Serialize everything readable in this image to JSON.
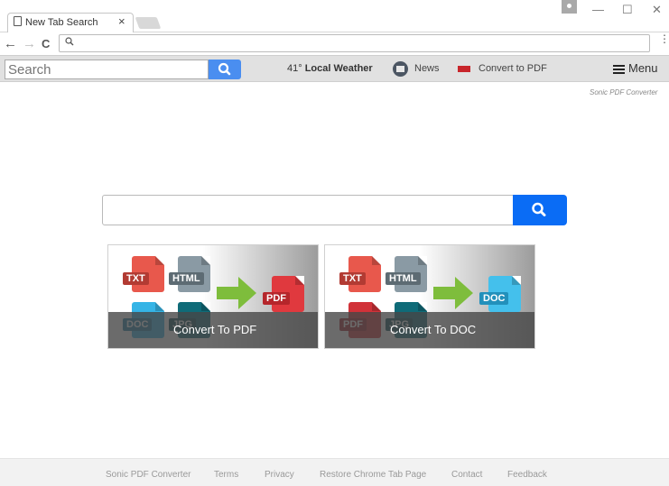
{
  "browser": {
    "tab_title": "New Tab Search",
    "tab_close": "×",
    "window_controls": {
      "minimize": "—",
      "maximize": "☐",
      "close": "✕"
    },
    "nav": {
      "back": "←",
      "forward": "→",
      "reload": "C"
    },
    "omnibox_value": "",
    "menu_glyph": "⋮"
  },
  "extension_bar": {
    "search_placeholder": "Search",
    "weather_temp": "41°",
    "weather_label": "Local Weather",
    "news_label": "News",
    "convert_label": "Convert to PDF",
    "menu_label": "Menu"
  },
  "brand_tag": "Sonic PDF Converter",
  "main_search": {
    "value": ""
  },
  "cards": [
    {
      "title": "Convert To PDF",
      "sources": [
        {
          "label": "TXT",
          "color": "#e8584c"
        },
        {
          "label": "HTML",
          "color": "#8a9aa4"
        },
        {
          "label": "DOC",
          "color": "#35b4e6"
        },
        {
          "label": "JPG",
          "color": "#0f6b78"
        }
      ],
      "target": {
        "label": "PDF",
        "color": "#e0393e"
      }
    },
    {
      "title": "Convert To DOC",
      "sources": [
        {
          "label": "TXT",
          "color": "#e8584c"
        },
        {
          "label": "HTML",
          "color": "#8a9aa4"
        },
        {
          "label": "PDF",
          "color": "#d13239"
        },
        {
          "label": "JPG",
          "color": "#0f6b78"
        }
      ],
      "target": {
        "label": "DOC",
        "color": "#44c0ec"
      }
    }
  ],
  "footer": {
    "links": [
      "Sonic PDF Converter",
      "Terms",
      "Privacy",
      "Restore Chrome Tab Page",
      "Contact",
      "Feedback"
    ]
  },
  "colors": {
    "search_button": "#0a6cf5",
    "ext_search_button": "#4a8ef0",
    "arrow": "#7ebd3c"
  }
}
